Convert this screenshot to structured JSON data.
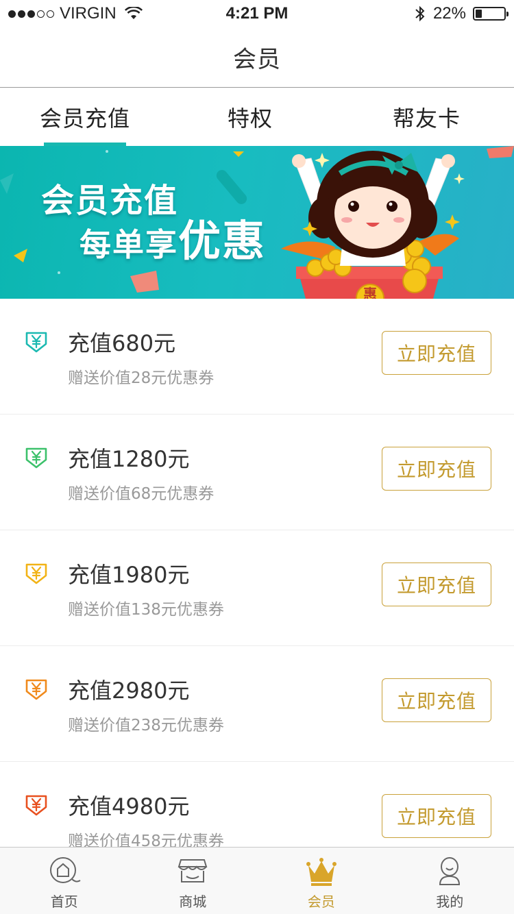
{
  "status_bar": {
    "carrier": "VIRGIN",
    "time": "4:21 PM",
    "battery": "22%",
    "battery_level": 0.22,
    "signal_bars": 3
  },
  "nav": {
    "title": "会员"
  },
  "tabs": [
    {
      "label": "会员充值",
      "active": true
    },
    {
      "label": "特权",
      "active": false
    },
    {
      "label": "帮友卡",
      "active": false
    }
  ],
  "banner": {
    "line1": "会员充值",
    "line2_prefix": "每单享",
    "line2_emphasis": "优惠",
    "box_char": "惠"
  },
  "items": [
    {
      "title": "充值680元",
      "subtitle": "赠送价值28元优惠券",
      "button": "立即充值",
      "color": "#1bb9b1",
      "icon": "yen-down-arrow-icon"
    },
    {
      "title": "充值1280元",
      "subtitle": "赠送价值68元优惠券",
      "button": "立即充值",
      "color": "#3cc16b",
      "icon": "yen-down-arrow-icon"
    },
    {
      "title": "充值1980元",
      "subtitle": "赠送价值138元优惠券",
      "button": "立即充值",
      "color": "#f2b316",
      "icon": "yen-down-arrow-icon"
    },
    {
      "title": "充值2980元",
      "subtitle": "赠送价值238元优惠券",
      "button": "立即充值",
      "color": "#f08a1c",
      "icon": "yen-down-arrow-icon"
    },
    {
      "title": "充值4980元",
      "subtitle": "赠送价值458元优惠券",
      "button": "立即充值",
      "color": "#e8501f",
      "icon": "yen-down-arrow-icon"
    }
  ],
  "tabbar": [
    {
      "label": "首页",
      "icon": "home-icon",
      "active": false
    },
    {
      "label": "商城",
      "icon": "store-icon",
      "active": false
    },
    {
      "label": "会员",
      "icon": "crown-icon",
      "active": true
    },
    {
      "label": "我的",
      "icon": "profile-icon",
      "active": false
    }
  ],
  "colors": {
    "accent_teal": "#18b8b0",
    "gold": "#c39a2e",
    "banner_bg": "#0bb6b0"
  }
}
